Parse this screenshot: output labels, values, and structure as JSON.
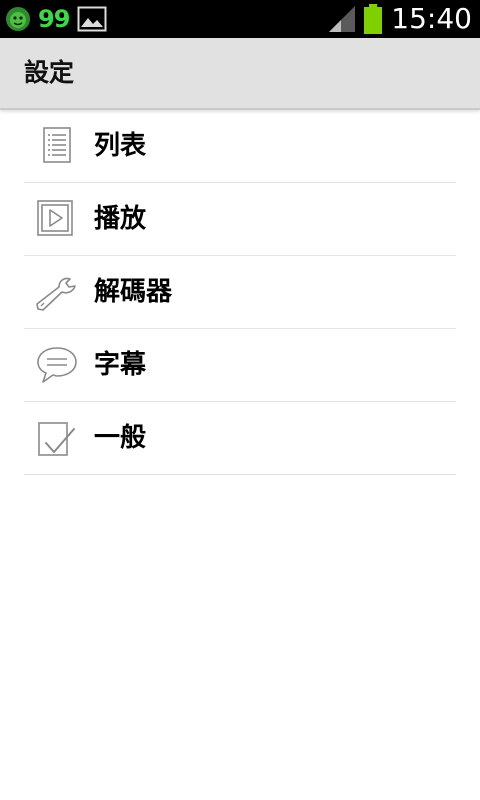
{
  "status_bar": {
    "battery_number": "99",
    "time": "15:40",
    "icons": [
      "lion-face-icon",
      "gallery-image-icon",
      "signal-strength-icon",
      "battery-icon"
    ],
    "battery_color": "#7ed000",
    "number_color": "#3fd64a"
  },
  "action_bar": {
    "title": "設定"
  },
  "list": {
    "items": [
      {
        "label": "列表",
        "icon": "list-document-icon"
      },
      {
        "label": "播放",
        "icon": "play-icon"
      },
      {
        "label": "解碼器",
        "icon": "wrench-icon"
      },
      {
        "label": "字幕",
        "icon": "speech-bubble-icon"
      },
      {
        "label": "一般",
        "icon": "checkbox-check-icon"
      }
    ]
  }
}
